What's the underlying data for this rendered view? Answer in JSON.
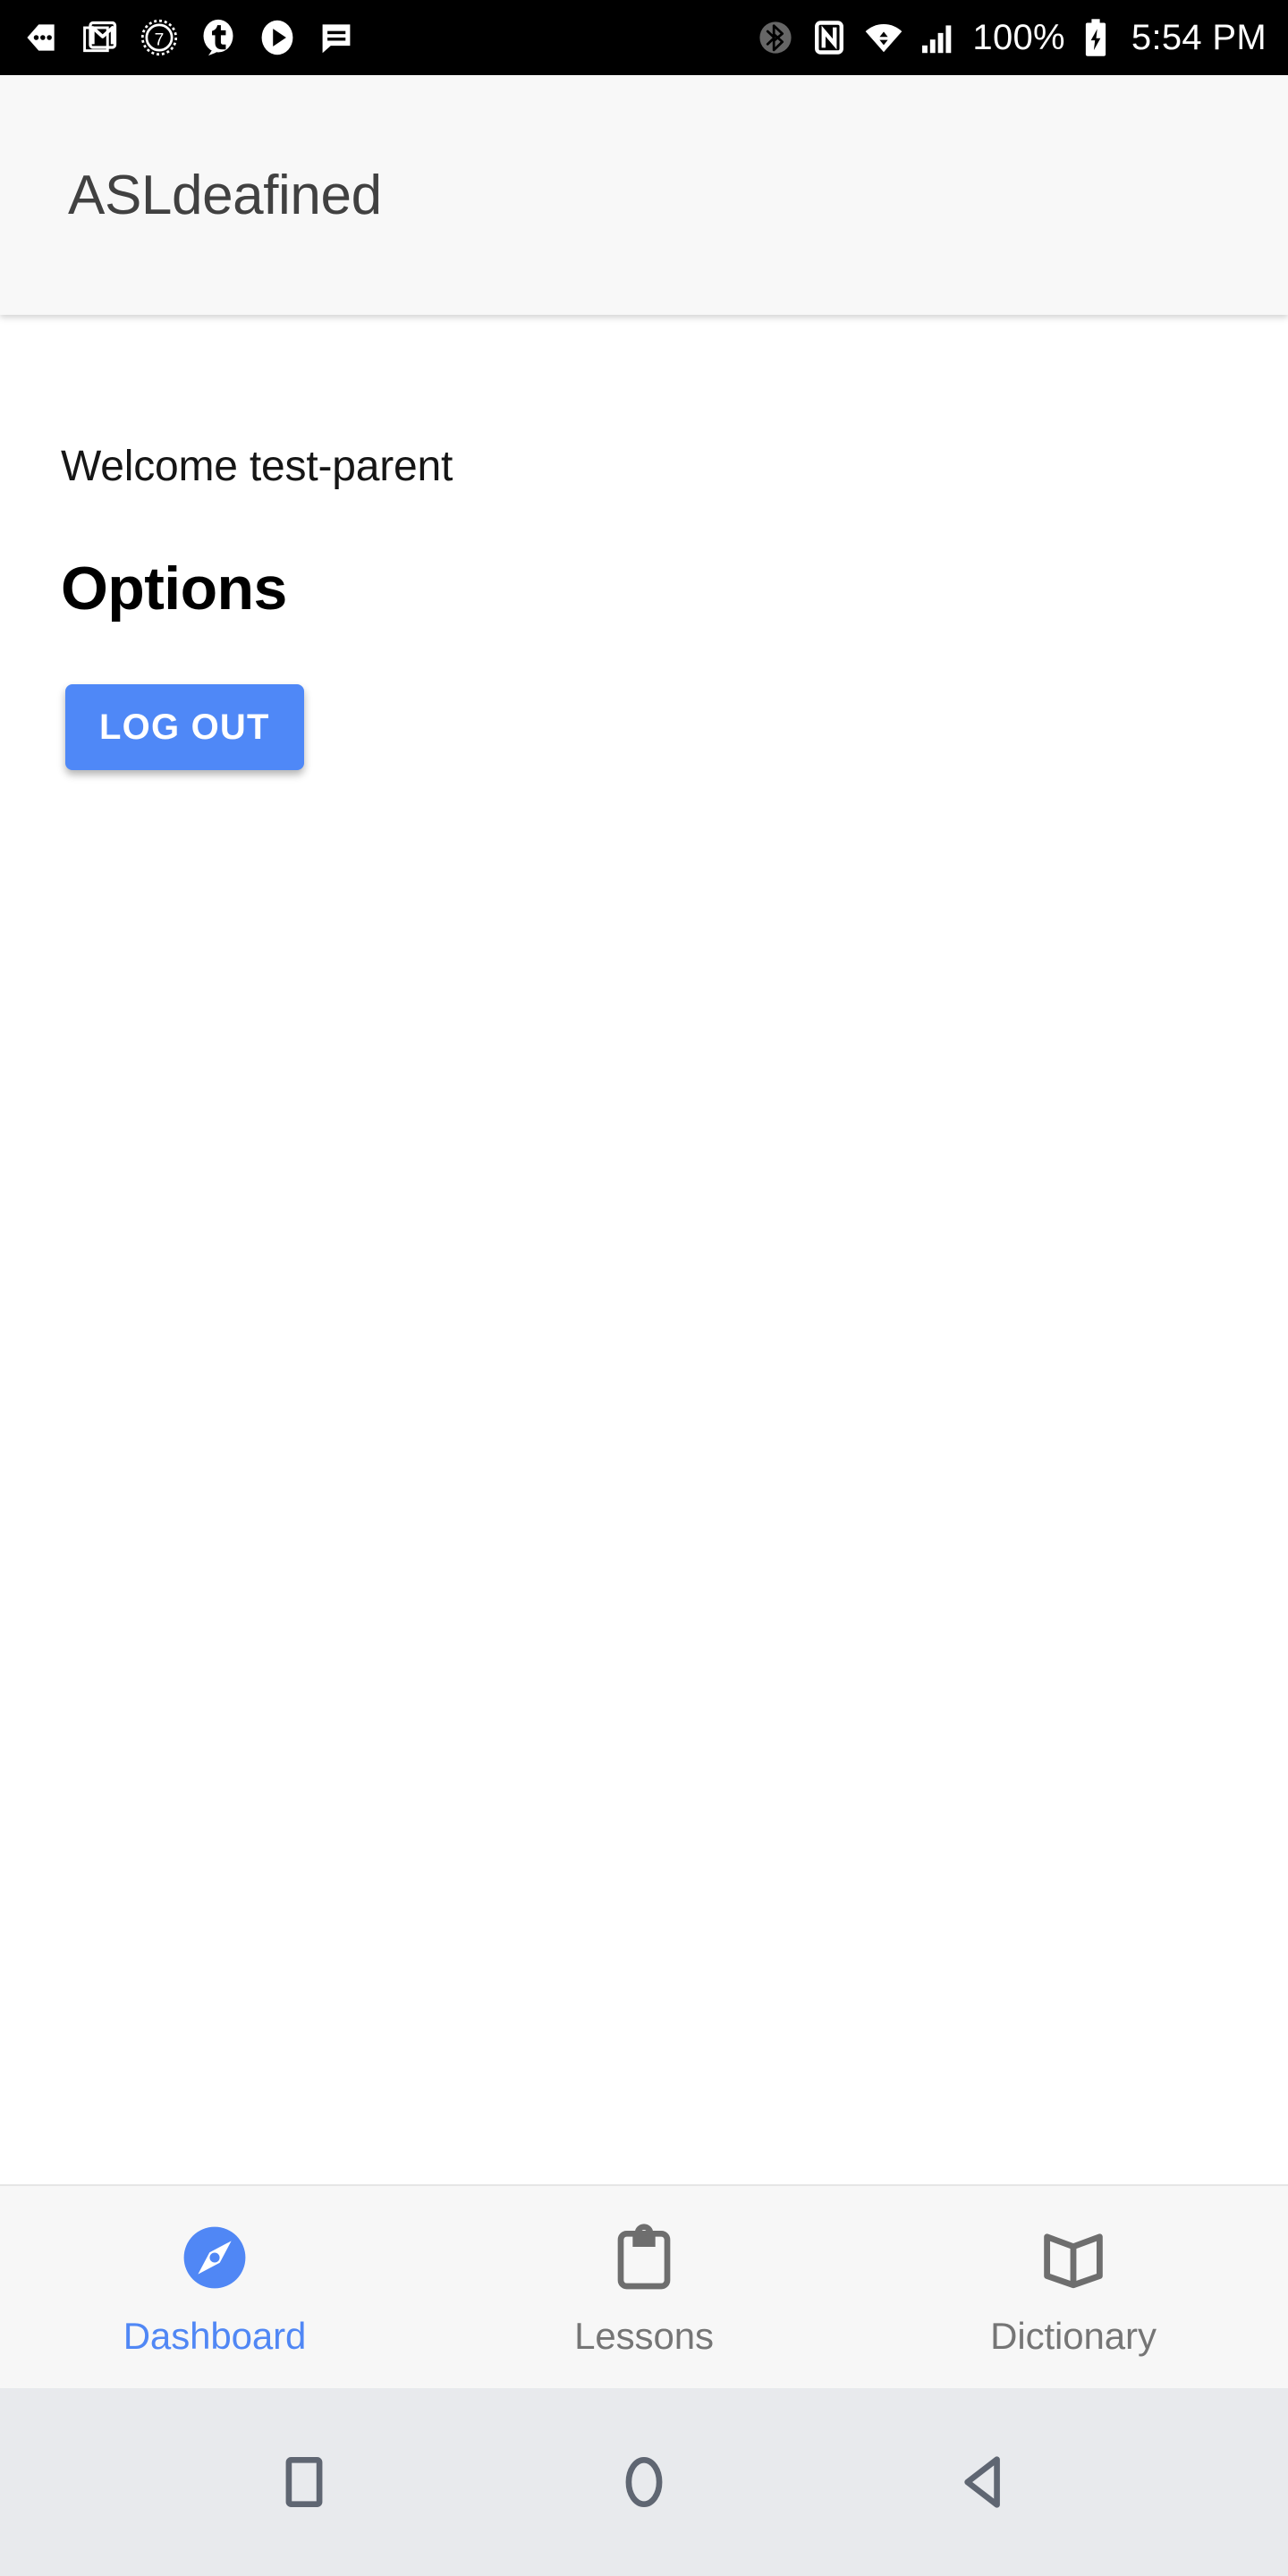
{
  "status_bar": {
    "background": "#000000",
    "left_icons": [
      {
        "name": "more-notifications-icon",
        "label": "more notifications"
      },
      {
        "name": "gmail-icon",
        "label": "Gmail"
      },
      {
        "name": "seven-clock-icon",
        "label": "7 alarm"
      },
      {
        "name": "tumblr-icon",
        "label": "Tumblr"
      },
      {
        "name": "play-icon",
        "label": "Play"
      },
      {
        "name": "message-icon",
        "label": "Messages"
      }
    ],
    "right_icons": [
      {
        "name": "bluetooth-icon",
        "label": "Bluetooth"
      },
      {
        "name": "nfc-icon",
        "label": "NFC"
      },
      {
        "name": "wifi-icon",
        "label": "Wi-Fi"
      },
      {
        "name": "cell-signal-icon",
        "label": "Cellular signal"
      },
      {
        "name": "battery-charging-icon",
        "label": "Battery charging"
      }
    ],
    "battery_percent": "100%",
    "time": "5:54 PM"
  },
  "app_bar": {
    "title": "ASLdeafined",
    "background": "#f8f8f8",
    "title_color": "#414141"
  },
  "main": {
    "welcome": "Welcome test-parent",
    "options_heading": "Options",
    "logout_label": "LOG OUT",
    "logout_color": "#4f88f7",
    "background": "#ffffff"
  },
  "tab_bar": {
    "background": "#f7f7f7",
    "active_color": "#5087f5",
    "inactive_color": "#757575",
    "tabs": [
      {
        "label": "Dashboard",
        "icon": "compass-icon",
        "active": true
      },
      {
        "label": "Lessons",
        "icon": "clipboard-icon",
        "active": false
      },
      {
        "label": "Dictionary",
        "icon": "open-book-icon",
        "active": false
      }
    ]
  },
  "system_nav": {
    "background": "#e8eaed",
    "buttons": [
      {
        "name": "recents-button",
        "icon": "square-icon"
      },
      {
        "name": "home-button",
        "icon": "circle-icon"
      },
      {
        "name": "back-button",
        "icon": "triangle-left-icon"
      }
    ]
  }
}
